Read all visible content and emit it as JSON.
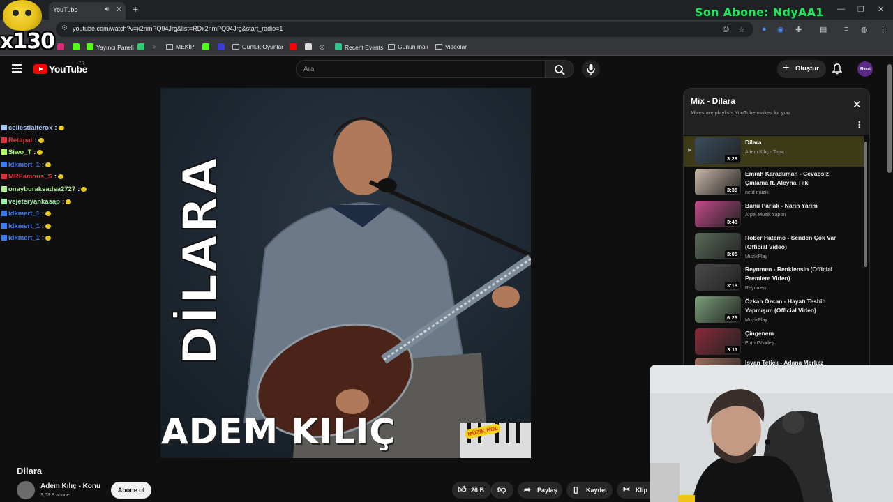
{
  "browser": {
    "tab_title": "YouTube",
    "url": "youtube.com/watch?v=x2nmPQ94Jrg&list=RDx2nmPQ94Jrg&start_radio=1",
    "bookmarks": [
      "Yayıncı Paneli",
      "MEKİP",
      "Günlük Oyunlar",
      "Recent Events",
      "Günün malı",
      "Videolar"
    ]
  },
  "stream_overlay": {
    "last_sub": "Son Abone: NdyAA1",
    "count": "x130"
  },
  "youtube": {
    "wordmark": "YouTube",
    "country": "TR",
    "search_placeholder": "Ara",
    "create_label": "Oluştur",
    "avatar_text": "Ahmet"
  },
  "chat": [
    {
      "name": "cellestialferox",
      "sep": ":",
      "color": "#a9c8ff"
    },
    {
      "name": "Retapai",
      "sep": ":",
      "color": "#e0313c"
    },
    {
      "name": "Siwo_T",
      "sep": ":",
      "color": "#a8ff5a"
    },
    {
      "name": "idkmert_1",
      "sep": ":",
      "color": "#3e7bf2"
    },
    {
      "name": "MRFamous_S",
      "sep": ":",
      "color": "#e0313c"
    },
    {
      "name": "onayburaksadsa2727",
      "sep": ":",
      "color": "#b4f09a"
    },
    {
      "name": "vejeteryankasap",
      "sep": ":",
      "color": "#9df0a8"
    },
    {
      "name": "idkmert_1",
      "sep": ":",
      "color": "#3e7bf2"
    },
    {
      "name": "idkmert_1",
      "sep": ":",
      "color": "#3e7bf2"
    },
    {
      "name": "idkmert_1",
      "sep": ":",
      "color": "#3e7bf2"
    }
  ],
  "video": {
    "cover_title": "DİLARA",
    "cover_artist": "ADEM KILIÇ",
    "cover_label": "MÜZİK HOL",
    "title": "Dilara",
    "channel": "Adem Kılıç - Konu",
    "subscribers": "3,03 B abone",
    "subscribe_label": "Abone ol",
    "likes": "26 B",
    "share_label": "Paylaş",
    "save_label": "Kaydet",
    "clip_label": "Klip"
  },
  "mix": {
    "title": "Mix - Dilara",
    "subtitle": "Mixes are playlists YouTube makes for you",
    "items": [
      {
        "title": "Dilara",
        "channel": "Adem Kılıç - Topic",
        "duration": "3:28",
        "thumb": "#3a4e5e"
      },
      {
        "title": "Emrah Karaduman - Cevapsız Çınlama ft. Aleyna Tilki",
        "channel": "netd müzik",
        "duration": "3:35",
        "thumb": "#c9b8a8"
      },
      {
        "title": "Banu Parlak - Narin Yarim",
        "channel": "Arpej Müzik Yapım",
        "duration": "3:48",
        "thumb": "#c44a8a"
      },
      {
        "title": "Rober Hatemo - Senden Çok Var (Official Video)",
        "channel": "MuzikPlay",
        "duration": "3:05",
        "thumb": "#5a6a5a"
      },
      {
        "title": "Reynmen - Renklensin (Official Premiere Video)",
        "channel": "Reynmen",
        "duration": "3:18",
        "thumb": "#4a4a4a"
      },
      {
        "title": "Özkan Özcan - Hayatı Tesbih Yapmışım (Official Video)",
        "channel": "MuzikPlay",
        "duration": "6:23",
        "thumb": "#7aa07a"
      },
      {
        "title": "Çingenem",
        "channel": "Ebru Gündeş",
        "duration": "3:11",
        "thumb": "#8a2a3a"
      },
      {
        "title": "İsyan Tetick - Adana Merkez",
        "channel": "",
        "duration": "",
        "thumb": "#a07060"
      }
    ]
  }
}
